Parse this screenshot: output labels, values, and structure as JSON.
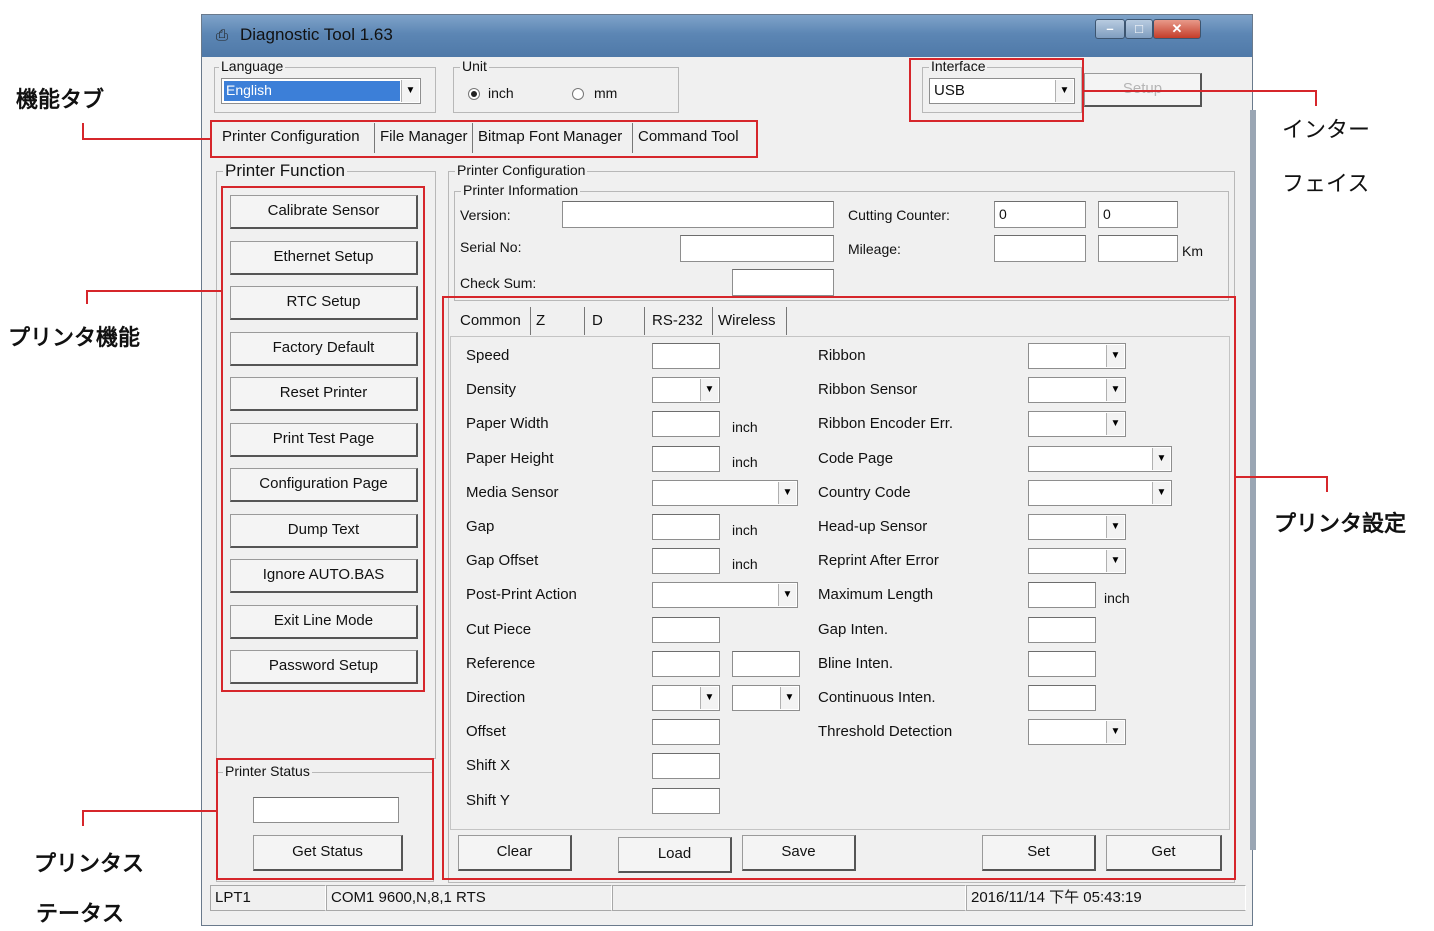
{
  "window": {
    "title": "Diagnostic Tool 1.63"
  },
  "language": {
    "label": "Language",
    "value": "English"
  },
  "unit": {
    "label": "Unit",
    "options": [
      "inch",
      "mm"
    ],
    "selected": "inch"
  },
  "interface": {
    "label": "Interface",
    "value": "USB",
    "setup_label": "Setup"
  },
  "tabs": [
    "Printer Configuration",
    "File Manager",
    "Bitmap Font Manager",
    "Command Tool"
  ],
  "printer_function": {
    "label": "Printer Function",
    "buttons": [
      "Calibrate Sensor",
      "Ethernet Setup",
      "RTC Setup",
      "Factory Default",
      "Reset Printer",
      "Print Test Page",
      "Configuration Page",
      "Dump Text",
      "Ignore AUTO.BAS",
      "Exit Line Mode",
      "Password Setup"
    ]
  },
  "printer_status": {
    "label": "Printer Status",
    "button": "Get Status"
  },
  "printer_config": {
    "label": "Printer Configuration",
    "info_label": "Printer Information",
    "version_label": "Version:",
    "serial_label": "Serial No:",
    "checksum_label": "Check Sum:",
    "cutting_label": "Cutting Counter:",
    "cutting_values": [
      "0",
      "0"
    ],
    "mileage_label": "Mileage:",
    "mileage_unit": "Km"
  },
  "subtabs": [
    "Common",
    "Z",
    "D",
    "RS-232",
    "Wireless"
  ],
  "settings_left": {
    "speed": "Speed",
    "density": "Density",
    "paper_width": "Paper Width",
    "paper_height": "Paper Height",
    "media_sensor": "Media Sensor",
    "gap": "Gap",
    "gap_offset": "Gap Offset",
    "post_print": "Post-Print Action",
    "cut_piece": "Cut Piece",
    "reference": "Reference",
    "direction": "Direction",
    "offset": "Offset",
    "shift_x": "Shift X",
    "shift_y": "Shift Y",
    "unit_inch": "inch"
  },
  "settings_right": {
    "ribbon": "Ribbon",
    "ribbon_sensor": "Ribbon Sensor",
    "ribbon_encoder": "Ribbon Encoder Err.",
    "code_page": "Code Page",
    "country_code": "Country Code",
    "headup_sensor": "Head-up Sensor",
    "reprint": "Reprint After Error",
    "max_length": "Maximum Length",
    "gap_inten": "Gap Inten.",
    "bline_inten": "Bline Inten.",
    "continuous_inten": "Continuous Inten.",
    "threshold": "Threshold Detection",
    "unit_inch": "inch"
  },
  "bottom_buttons": [
    "Clear",
    "Load",
    "Save",
    "Set",
    "Get"
  ],
  "statusbar": {
    "port": "LPT1",
    "com": "COM1 9600,N,8,1 RTS",
    "blank": "",
    "datetime": "2016/11/14 下午 05:43:19"
  },
  "annotations": {
    "function_tab": "機能タブ",
    "interface_1": "インター",
    "interface_2": "フェイス",
    "printer_function": "プリンタ機能",
    "printer_settings": "プリンタ設定",
    "printer_status_1": "プリンタス",
    "printer_status_2": "テータス"
  },
  "colors": {
    "annotation_red": "#d6262b",
    "titlebar": "#5c86b4",
    "close_button": "#c43d2a"
  }
}
